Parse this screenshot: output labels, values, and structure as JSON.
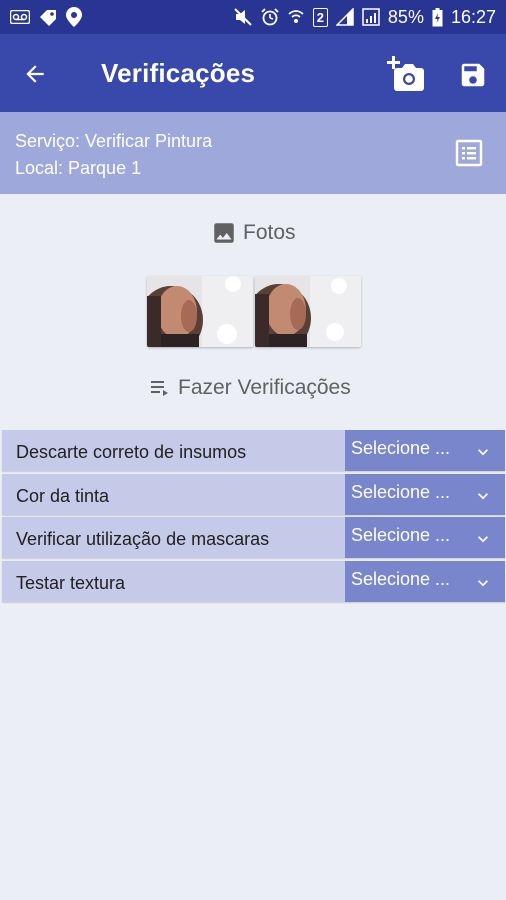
{
  "status_bar": {
    "battery": "85%",
    "time": "16:27",
    "sim_badge": "2"
  },
  "header": {
    "title": "Verificações"
  },
  "info": {
    "service": "Serviço: Verificar Pintura",
    "location": "Local: Parque 1"
  },
  "photos": {
    "title": "Fotos",
    "count": 2
  },
  "verifications": {
    "title": "Fazer Verificações",
    "items": [
      {
        "label": "Descarte correto de insumos",
        "value": "Selecione ..."
      },
      {
        "label": "Cor da tinta",
        "value": "Selecione ..."
      },
      {
        "label": "Verificar utilização de mascaras",
        "value": "Selecione ..."
      },
      {
        "label": "Testar textura",
        "value": "Selecione ..."
      }
    ]
  },
  "colors": {
    "status_bar": "#283593",
    "app_bar": "#3949ab",
    "info_bar": "#9fa8da",
    "row_bg": "#c5cae9",
    "select_bg": "#7986cb",
    "page_bg": "#eceef6"
  }
}
